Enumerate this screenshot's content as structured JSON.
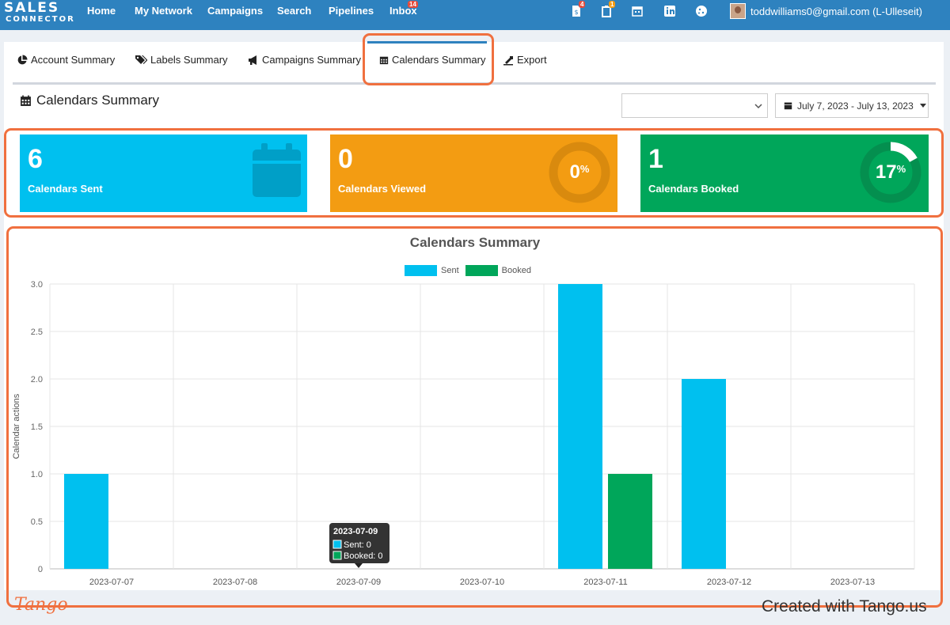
{
  "app": {
    "logo_top": "SALES",
    "logo_bottom": "CONNECTOR"
  },
  "nav": {
    "items": [
      "Home",
      "My Network",
      "Campaigns",
      "Search",
      "Pipelines",
      "Inbox"
    ],
    "inbox_badge": "14",
    "icon_badges": [
      "4",
      "1"
    ],
    "user": "toddwilliams0@gmail.com (L-Ulleseit)"
  },
  "tabs": [
    {
      "label": "Account Summary",
      "icon": "pie-chart-icon"
    },
    {
      "label": "Labels Summary",
      "icon": "tags-icon"
    },
    {
      "label": "Campaigns Summary",
      "icon": "bullhorn-icon"
    },
    {
      "label": "Calendars Summary",
      "icon": "calendar-icon",
      "active": true
    },
    {
      "label": "Export",
      "icon": "export-icon"
    }
  ],
  "page": {
    "title": "Calendars Summary",
    "select_value": "",
    "date_range": "July 7, 2023 - July 13, 2023"
  },
  "stats": [
    {
      "value": "6",
      "label": "Calendars Sent",
      "color": "#00c0ef"
    },
    {
      "value": "0",
      "label": "Calendars Viewed",
      "percent": "0",
      "percent_sign": "%",
      "color": "#f39c12"
    },
    {
      "value": "1",
      "label": "Calendars Booked",
      "percent": "17",
      "percent_sign": "%",
      "color": "#00a65a"
    }
  ],
  "chart_data": {
    "type": "bar",
    "title": "Calendars Summary",
    "ylabel": "Calendar actions",
    "xlabel": "",
    "categories": [
      "2023-07-07",
      "2023-07-08",
      "2023-07-09",
      "2023-07-10",
      "2023-07-11",
      "2023-07-12",
      "2023-07-13"
    ],
    "series": [
      {
        "name": "Sent",
        "color": "#00c0ef",
        "values": [
          1,
          0,
          0,
          0,
          3,
          2,
          0
        ]
      },
      {
        "name": "Booked",
        "color": "#00a65a",
        "values": [
          0,
          0,
          0,
          0,
          1,
          0,
          0
        ]
      }
    ],
    "ylim": [
      0,
      3
    ],
    "yticks": [
      "0",
      "0.5",
      "1.0",
      "1.5",
      "2.0",
      "2.5",
      "3.0"
    ],
    "grid": true,
    "legend": "top",
    "tooltip": {
      "title": "2023-07-09",
      "lines": [
        "Sent: 0",
        "Booked: 0"
      ]
    }
  },
  "footer": {
    "left": "Tango",
    "right": "Created with Tango.us"
  }
}
